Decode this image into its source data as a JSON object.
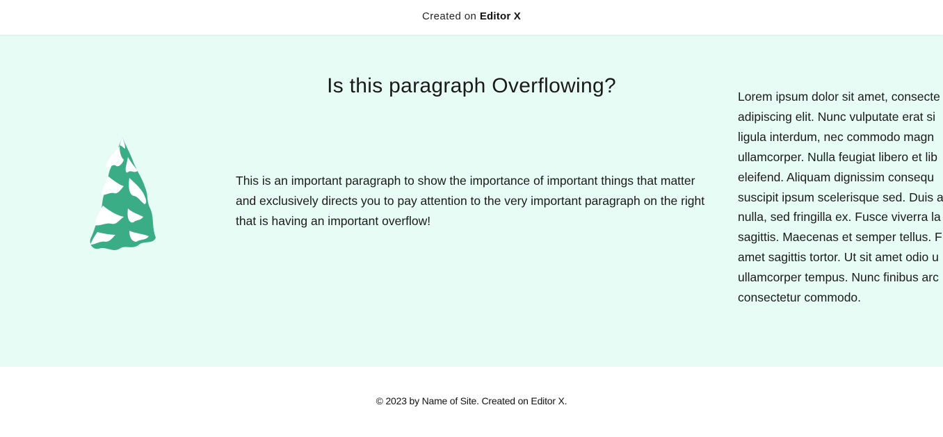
{
  "topbar": {
    "prefix": "Created on",
    "brand": "Editor X"
  },
  "hero": {
    "title": "Is this paragraph Overflowing?",
    "important_paragraph": "This is an important paragraph to show the importance of important things that matter and exclusively directs you to pay attention to the very important paragraph on the right that is having an important overflow!",
    "lorem_lines": [
      "Lorem ipsum dolor sit amet, consecte",
      "adipiscing elit. Nunc vulputate erat si",
      "ligula interdum, nec commodo magn",
      "ullamcorper. Nulla feugiat libero et lib",
      "eleifend. Aliquam dignissim consequ",
      "suscipit ipsum scelerisque sed. Duis a",
      "nulla, sed fringilla ex. Fusce viverra la",
      "sagittis. Maecenas et semper tellus. F",
      "amet sagittis tortor. Ut sit amet odio u",
      "ullamcorper tempus. Nunc finibus arc",
      "consectetur commodo."
    ],
    "background_color": "#e8fcf6",
    "tree_icon": "snowy-pine-tree-icon",
    "tree_color": "#3aad86"
  },
  "footer": {
    "text": "© 2023 by Name of Site. Created on Editor X."
  }
}
